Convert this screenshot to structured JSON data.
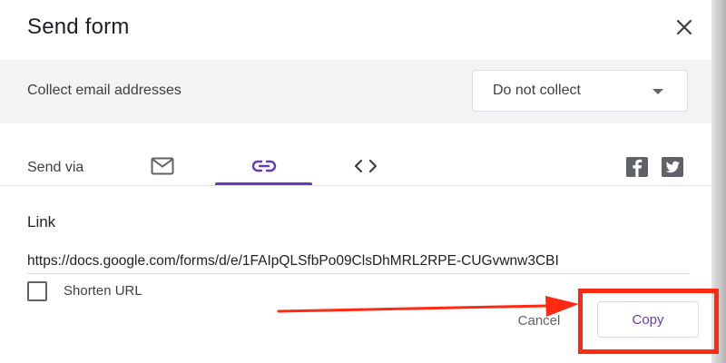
{
  "dialog": {
    "title": "Send form",
    "close_icon": "close-icon"
  },
  "collect": {
    "label": "Collect email addresses",
    "selected": "Do not collect"
  },
  "send_via": {
    "label": "Send via",
    "tabs": [
      {
        "name": "email",
        "icon": "mail-icon",
        "selected": false
      },
      {
        "name": "link",
        "icon": "link-icon",
        "selected": true
      },
      {
        "name": "embed",
        "icon": "code-icon",
        "selected": false
      }
    ],
    "social": [
      "facebook-icon",
      "twitter-icon"
    ]
  },
  "link_section": {
    "label": "Link",
    "url": "https://docs.google.com/forms/d/e/1FAIpQLSfbPo09ClsDhMRL2RPE-CUGvwnw3CBI",
    "shorten_label": "Shorten URL",
    "shorten_checked": false
  },
  "actions": {
    "cancel": "Cancel",
    "copy": "Copy"
  },
  "colors": {
    "accent": "#673ab7",
    "annotation": "#ff2a12",
    "section_bg": "#f1f3f4"
  }
}
